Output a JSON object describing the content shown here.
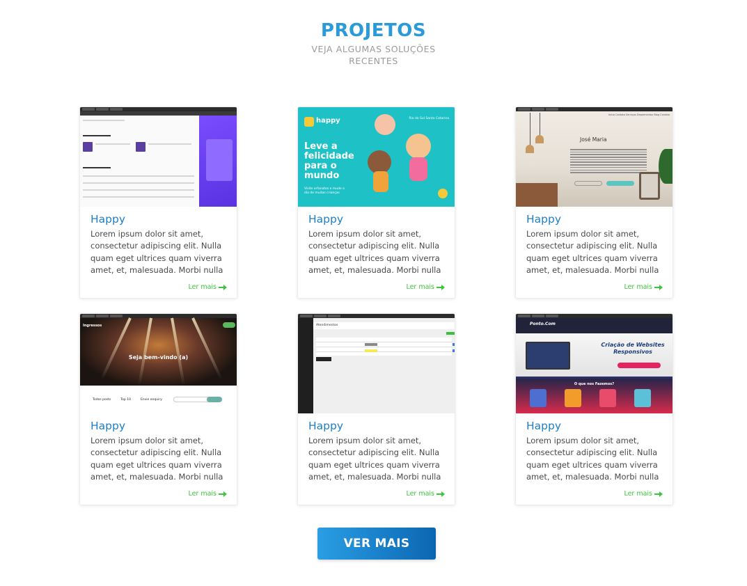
{
  "header": {
    "title": "PROJETOS",
    "subtitle": "VEJA ALGUMAS SOLUÇÕES RECENTES"
  },
  "cards": [
    {
      "title": "Happy",
      "text": "Lorem ipsum dolor sit amet, consectetur adipiscing elit. Nulla quam eget ultrices quam viverra amet, et, malesuada. Morbi nulla",
      "link": "Ler mais",
      "thumbnail": "podcast-app-screenshot"
    },
    {
      "title": "Happy",
      "text": "Lorem ipsum dolor sit amet, consectetur adipiscing elit. Nulla quam eget ultrices quam viverra amet, et, malesuada. Morbi nulla",
      "link": "Ler mais",
      "thumbnail": "happy-landing-screenshot"
    },
    {
      "title": "Happy",
      "text": "Lorem ipsum dolor sit amet, consectetur adipiscing elit. Nulla quam eget ultrices quam viverra amet, et, malesuada. Morbi nulla",
      "link": "Ler mais",
      "thumbnail": "psychologist-site-screenshot"
    },
    {
      "title": "Happy",
      "text": "Lorem ipsum dolor sit amet, consectetur adipiscing elit. Nulla quam eget ultrices quam viverra amet, et, malesuada. Morbi nulla",
      "link": "Ler mais",
      "thumbnail": "concert-site-screenshot"
    },
    {
      "title": "Happy",
      "text": "Lorem ipsum dolor sit amet, consectetur adipiscing elit. Nulla quam eget ultrices quam viverra amet, et, malesuada. Morbi nulla",
      "link": "Ler mais",
      "thumbnail": "dashboard-table-screenshot"
    },
    {
      "title": "Happy",
      "text": "Lorem ipsum dolor sit amet, consectetur adipiscing elit. Nulla quam eget ultrices quam viverra amet, et, malesuada. Morbi nulla",
      "link": "Ler mais",
      "thumbnail": "web-agency-screenshot"
    }
  ],
  "thumbs": {
    "happy": {
      "logo": "happy",
      "headline": "Leve a felicidade para o mundo",
      "tagline": "Visite orfanatos e mude o dia de muitas crianças",
      "location": "Rio do Sul Santa Catarina"
    },
    "jose": {
      "name": "José Maria",
      "nav": "Inicio Contato Serviços Depoimentos Blog Contato"
    },
    "concert": {
      "welcome": "Seja bem-vindo (a)",
      "logo": "Ingressos",
      "tabs": [
        "Todos posts",
        "Top 10",
        "Envie enquiry"
      ]
    },
    "dash": {
      "title": "Atendimentos",
      "button": "Enviar Item"
    },
    "agency": {
      "logo": "Ponto.Com",
      "headline": "Criação de Websites Responsivos",
      "section": "O que nos Fazemos?"
    }
  },
  "cta": {
    "label": "VER MAIS"
  },
  "colors": {
    "title": "#2a9ad8",
    "card_title": "#1d7fc4",
    "link": "#3cc43c",
    "button_from": "#2a9ee4",
    "button_to": "#0b66b2"
  }
}
